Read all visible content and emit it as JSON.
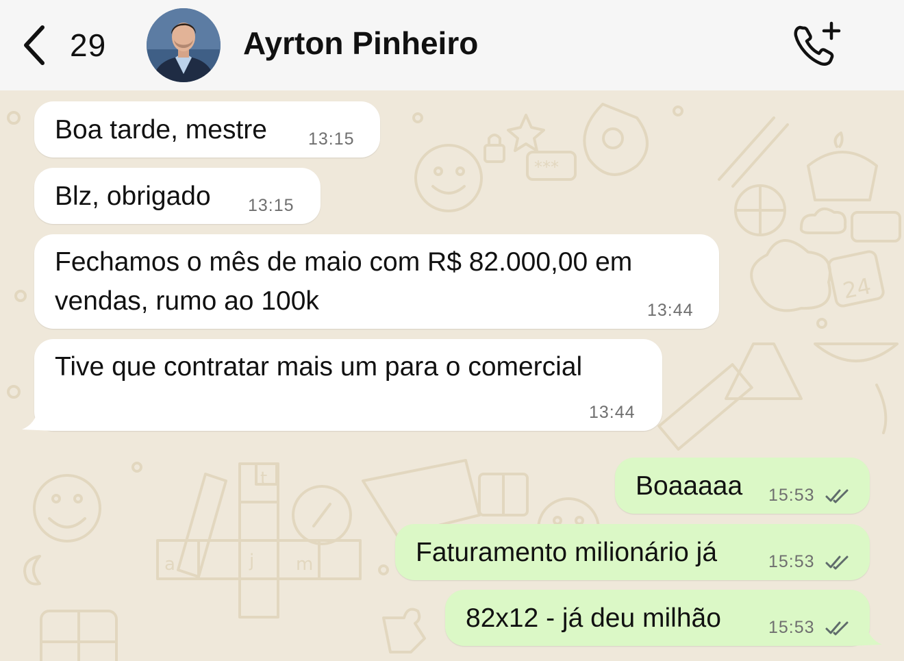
{
  "header": {
    "unread_count": "29",
    "contact_name": "Ayrton Pinheiro"
  },
  "colors": {
    "incoming_bubble": "#ffffff",
    "outgoing_bubble": "#dbf8c6",
    "chat_background": "#efe8da",
    "doodle_stroke": "#e3d9c3",
    "header_background": "#f6f6f6",
    "read_ticks": "#5f6b6b"
  },
  "messages": [
    {
      "direction": "incoming",
      "text": "Boa tarde, mestre",
      "time": "13:15"
    },
    {
      "direction": "incoming",
      "text": "Blz, obrigado",
      "time": "13:15"
    },
    {
      "direction": "incoming",
      "text_line_1": "Fechamos o mês de maio com R$ 82.000,00 em",
      "text_line_2": "vendas, rumo ao 100k",
      "time": "13:44"
    },
    {
      "direction": "incoming",
      "text": "Tive que contratar mais um para o comercial",
      "time": "13:44"
    },
    {
      "direction": "outgoing",
      "text": "Boaaaaa",
      "time": "15:53",
      "status_icon": "double-check-icon"
    },
    {
      "direction": "outgoing",
      "text": "Faturamento milionário já",
      "time": "15:53",
      "status_icon": "double-check-icon"
    },
    {
      "direction": "outgoing",
      "text": "82x12 - já deu milhão",
      "time": "15:53",
      "status_icon": "double-check-icon"
    }
  ]
}
